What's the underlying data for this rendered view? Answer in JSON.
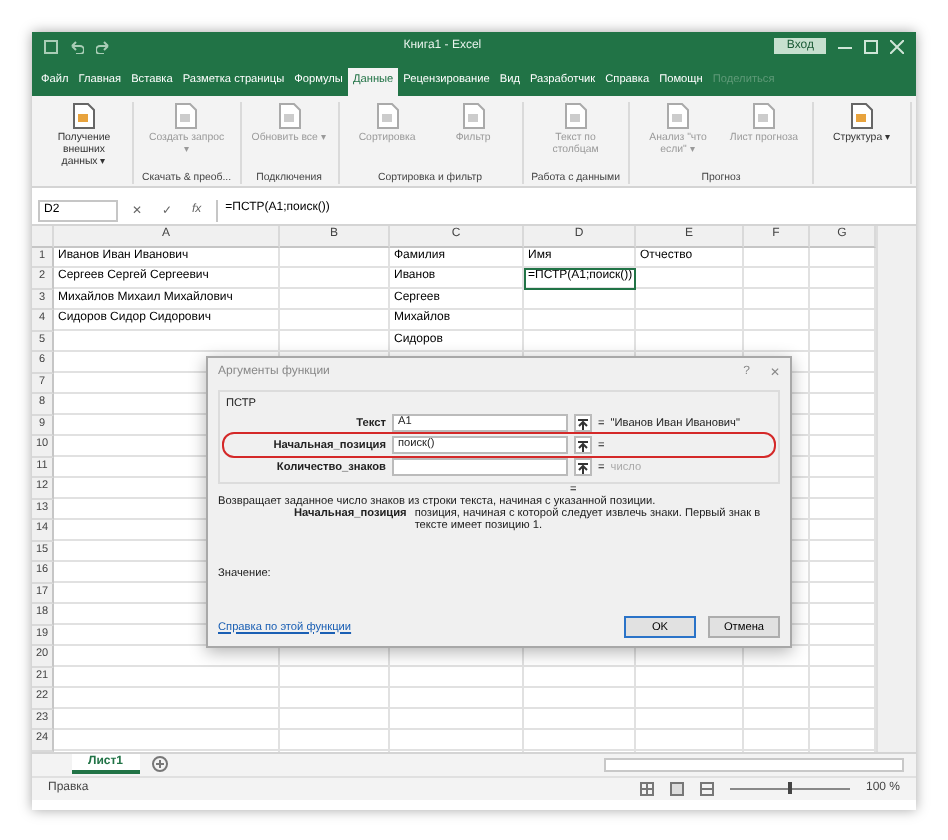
{
  "window": {
    "title": "Книга1 - Excel",
    "signin": "Вход"
  },
  "tabs": [
    {
      "label": "Файл",
      "selected": false,
      "disabled": false
    },
    {
      "label": "Главная",
      "selected": false,
      "disabled": false
    },
    {
      "label": "Вставка",
      "selected": false,
      "disabled": false
    },
    {
      "label": "Разметка страницы",
      "selected": false,
      "disabled": false
    },
    {
      "label": "Формулы",
      "selected": false,
      "disabled": false
    },
    {
      "label": "Данные",
      "selected": true,
      "disabled": false
    },
    {
      "label": "Рецензирование",
      "selected": false,
      "disabled": false
    },
    {
      "label": "Вид",
      "selected": false,
      "disabled": false
    },
    {
      "label": "Разработчик",
      "selected": false,
      "disabled": false
    },
    {
      "label": "Справка",
      "selected": false,
      "disabled": false
    },
    {
      "label": "Помощн",
      "selected": false,
      "disabled": false
    },
    {
      "label": "Поделиться",
      "selected": false,
      "disabled": true
    }
  ],
  "ribbon": [
    {
      "buttons": [
        {
          "label": "Получение внешних данных ▾",
          "disabled": false
        }
      ]
    },
    {
      "group": "Скачать & преоб...",
      "buttons": [
        {
          "label": "Создать запрос ▾",
          "disabled": true
        }
      ]
    },
    {
      "group": "Подключения",
      "buttons": [
        {
          "label": "Обновить все ▾",
          "disabled": true
        }
      ]
    },
    {
      "group": "Сортировка и фильтр",
      "buttons": [
        {
          "label": "Сортировка",
          "disabled": true
        },
        {
          "label": "Фильтр",
          "disabled": true
        }
      ]
    },
    {
      "group": "Работа с данными",
      "buttons": [
        {
          "label": "Текст по столбцам",
          "disabled": true
        }
      ]
    },
    {
      "group": "Прогноз",
      "buttons": [
        {
          "label": "Анализ \"что если\" ▾",
          "disabled": true
        },
        {
          "label": "Лист прогноза",
          "disabled": true
        }
      ]
    },
    {
      "buttons": [
        {
          "label": "Структура ▾",
          "disabled": false
        }
      ]
    }
  ],
  "formula_bar": {
    "name_box": "D2",
    "cancel": "✕",
    "enter": "✓",
    "function": "fx",
    "formula": "=ПСТР(A1;поиск())"
  },
  "sheet": {
    "columns": [
      "A",
      "B",
      "C",
      "D",
      "E",
      "F",
      "G"
    ],
    "rows": [
      {
        "number": "1",
        "cells": [
          {
            "text": "Иванов Иван Иванович",
            "active": false
          },
          null,
          {
            "text": "Фамилия",
            "active": false
          },
          {
            "text": "Имя",
            "active": false
          },
          {
            "text": "Отчество",
            "active": false
          }
        ]
      },
      {
        "number": "2",
        "cells": [
          {
            "text": "Сергеев Сергей Сергеевич",
            "active": false
          },
          null,
          {
            "text": "Иванов",
            "active": false
          },
          {
            "text": "=ПСТР(A1;поиск())",
            "active": true
          }
        ]
      },
      {
        "number": "3",
        "cells": [
          {
            "text": "Михайлов Михаил Михайлович",
            "active": false
          },
          null,
          {
            "text": "Сергеев",
            "active": false
          }
        ]
      },
      {
        "number": "4",
        "cells": [
          {
            "text": "Сидоров Сидор Сидорович",
            "active": false
          },
          null,
          {
            "text": "Михайлов",
            "active": false
          }
        ]
      },
      {
        "number": "5",
        "cells": [
          null,
          null,
          {
            "text": "Сидоров",
            "active": false
          }
        ]
      },
      {
        "number": "6"
      },
      {
        "number": "7"
      },
      {
        "number": "8"
      },
      {
        "number": "9"
      },
      {
        "number": "10"
      },
      {
        "number": "11"
      },
      {
        "number": "12"
      },
      {
        "number": "13"
      },
      {
        "number": "14"
      },
      {
        "number": "15"
      },
      {
        "number": "16"
      },
      {
        "number": "17"
      },
      {
        "number": "18"
      },
      {
        "number": "19"
      },
      {
        "number": "20"
      },
      {
        "number": "21"
      },
      {
        "number": "22"
      },
      {
        "number": "23"
      },
      {
        "number": "24"
      }
    ]
  },
  "dialog": {
    "title": "Аргументы функции",
    "help": "?",
    "close": "✕",
    "function": "ПСТР",
    "arguments": [
      {
        "label": "Текст",
        "value": "A1",
        "equals": "=",
        "result": "\"Иванов Иван Иванович\"",
        "hint": false,
        "highlighted": false
      },
      {
        "label": "Начальная_позиция",
        "value": "поиск()",
        "equals": "=",
        "highlighted": true
      },
      {
        "label": "Количество_знаков",
        "equals": "=",
        "result": "число",
        "hint": true,
        "highlighted": false
      }
    ],
    "total": "=",
    "description": "Возвращает заданное число знаков из строки текста, начиная с указанной позиции.",
    "param_name": "Начальная_позиция",
    "param_description": "позиция, начиная с которой следует извлечь знаки. Первый знак в тексте имеет позицию 1.",
    "value_label": "Значение:",
    "help_link": "Справка по этой функции",
    "buttons": [
      {
        "label": "OK",
        "selected": true
      },
      {
        "label": "Отмена",
        "selected": false
      }
    ]
  },
  "sheet_tabs": [
    {
      "label": "Лист1",
      "selected": true
    }
  ],
  "status_bar": {
    "mode": "Правка",
    "zoom": "100 %",
    "zoom_level": {
      "level": 0.5
    }
  }
}
